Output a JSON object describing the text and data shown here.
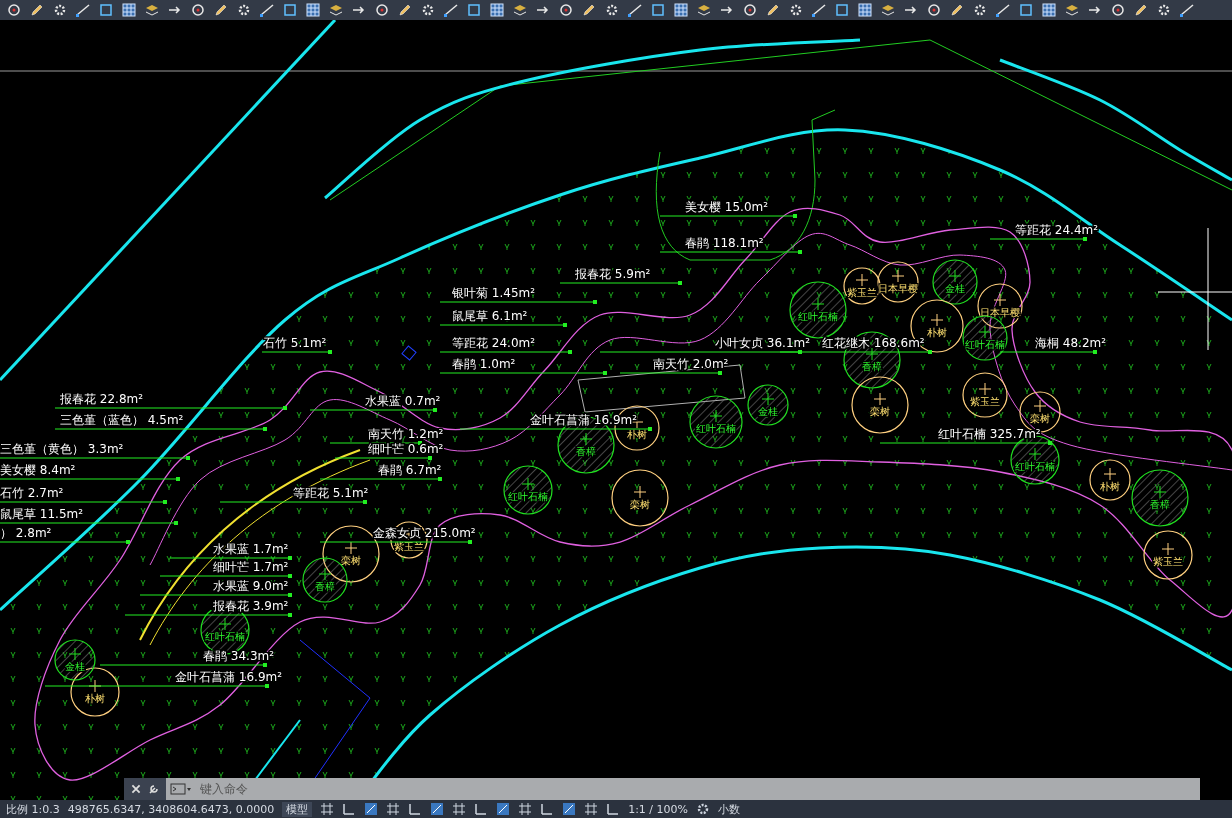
{
  "drawing": {
    "area_labels": [
      "美女樱 15.0m²",
      "等距花 24.4m²",
      "春鹃 118.1m²",
      "报春花 5.9m²",
      "银叶菊 1.45m²",
      "鼠尾草 6.1m²",
      "石竹 5.1m²",
      "等距花 24.0m²",
      "小叶女贞 36.1m²",
      "红花继木 168.6m²",
      "海桐 48.2m²",
      "春鹃 1.0m²",
      "南天竹 2.0m²",
      "报春花 22.8m²",
      "水果蓝 0.7m²",
      "三色堇（蓝色） 4.5m²",
      "金叶石菖蒲 16.9m²",
      "南天竹 1.2m²",
      "红叶石楠 325.7m²",
      "三色堇（黄色） 3.3m²",
      "细叶芒 0.6m²",
      "美女樱 8.4m²",
      "春鹃 6.7m²",
      "石竹 2.7m²",
      "等距花 5.1m²",
      "鼠尾草 11.5m²",
      "） 2.8m²",
      "金森女贞 215.0m²",
      "水果蓝 1.7m²",
      "细叶芒 1.7m²",
      "水果蓝 9.0m²",
      "报春花 3.9m²",
      "春鹃 34.3m²",
      "金叶石菖蒲 16.9m²"
    ],
    "trees": [
      {
        "name": "红叶石楠",
        "kind": "evergreen"
      },
      {
        "name": "紫玉兰",
        "kind": "deciduous"
      },
      {
        "name": "日本早樱",
        "kind": "deciduous"
      },
      {
        "name": "金桂",
        "kind": "evergreen"
      },
      {
        "name": "日本早樱",
        "kind": "deciduous"
      },
      {
        "name": "朴树",
        "kind": "deciduous"
      },
      {
        "name": "香樟",
        "kind": "evergreen"
      },
      {
        "name": "红叶石楠",
        "kind": "evergreen"
      },
      {
        "name": "栾树",
        "kind": "deciduous"
      },
      {
        "name": "金桂",
        "kind": "evergreen"
      },
      {
        "name": "红叶石楠",
        "kind": "evergreen"
      },
      {
        "name": "朴树",
        "kind": "deciduous"
      },
      {
        "name": "香樟",
        "kind": "evergreen"
      },
      {
        "name": "栾树",
        "kind": "deciduous"
      },
      {
        "name": "红叶石楠",
        "kind": "evergreen"
      },
      {
        "name": "紫玉兰",
        "kind": "deciduous"
      },
      {
        "name": "栾树",
        "kind": "deciduous"
      },
      {
        "name": "红叶石楠",
        "kind": "evergreen"
      },
      {
        "name": "香樟",
        "kind": "evergreen"
      },
      {
        "name": "紫玉兰",
        "kind": "deciduous"
      },
      {
        "name": "朴树",
        "kind": "deciduous"
      },
      {
        "name": "栾树",
        "kind": "deciduous"
      },
      {
        "name": "香樟",
        "kind": "evergreen"
      },
      {
        "name": "紫玉兰",
        "kind": "deciduous"
      },
      {
        "name": "红叶石楠",
        "kind": "evergreen"
      },
      {
        "name": "朴树",
        "kind": "deciduous"
      },
      {
        "name": "金桂",
        "kind": "evergreen"
      }
    ]
  },
  "command_line": {
    "placeholder": "键入命令"
  },
  "status_bar": {
    "scale": "比例 1:0.3",
    "coordinates": "498765.6347, 3408604.6473, 0.0000",
    "space": "模型",
    "annotation_scale": "1:1 / 100%",
    "units": "小数"
  }
}
